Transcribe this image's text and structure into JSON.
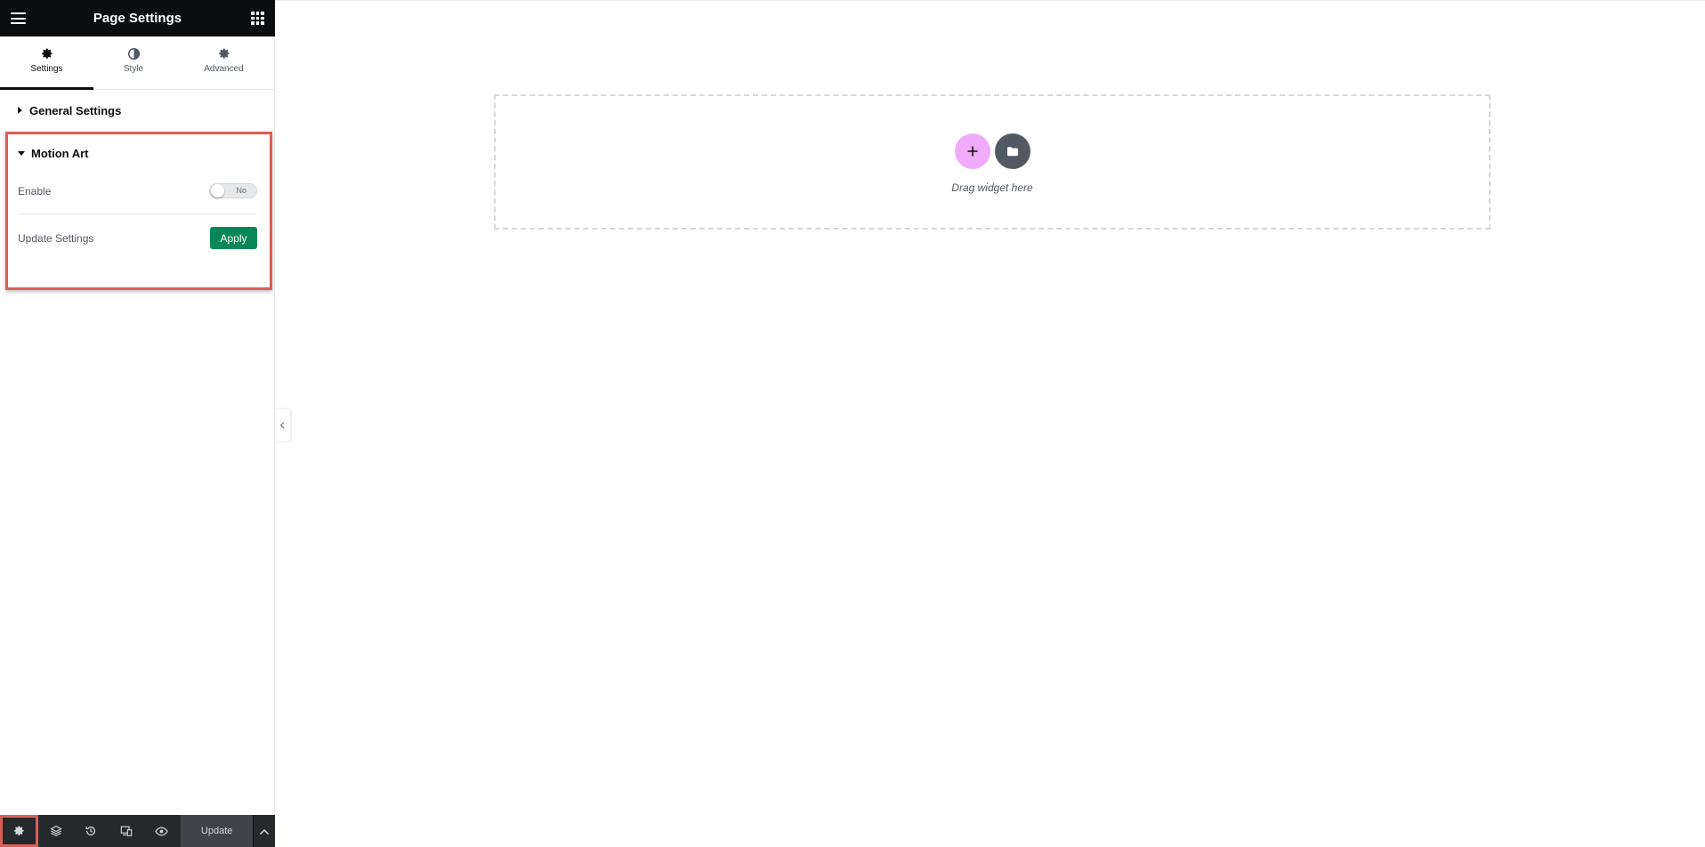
{
  "panel": {
    "title": "Page Settings",
    "tabs": [
      {
        "label": "Settings",
        "icon": "gear-icon",
        "active": true
      },
      {
        "label": "Style",
        "icon": "half-circle-icon",
        "active": false
      },
      {
        "label": "Advanced",
        "icon": "gear-icon",
        "active": false
      }
    ],
    "sections": {
      "general": {
        "label": "General Settings",
        "expanded": false
      },
      "motion_art": {
        "label": "Motion Art",
        "expanded": true,
        "enable_label": "Enable",
        "enable_toggle_text": "No",
        "update_label": "Update Settings",
        "apply_label": "Apply"
      }
    }
  },
  "footer": {
    "buttons": [
      "settings-icon",
      "layers-icon",
      "history-icon",
      "responsive-icon",
      "preview-eye-icon"
    ],
    "update_label": "Update"
  },
  "canvas": {
    "drop_text": "Drag widget here"
  },
  "colors": {
    "header_bg": "#0c0d0e",
    "accent_highlight": "#d95f56",
    "apply_green": "#0a875a",
    "add_button_pink": "#f0abfc",
    "footer_bg": "#26292c"
  }
}
